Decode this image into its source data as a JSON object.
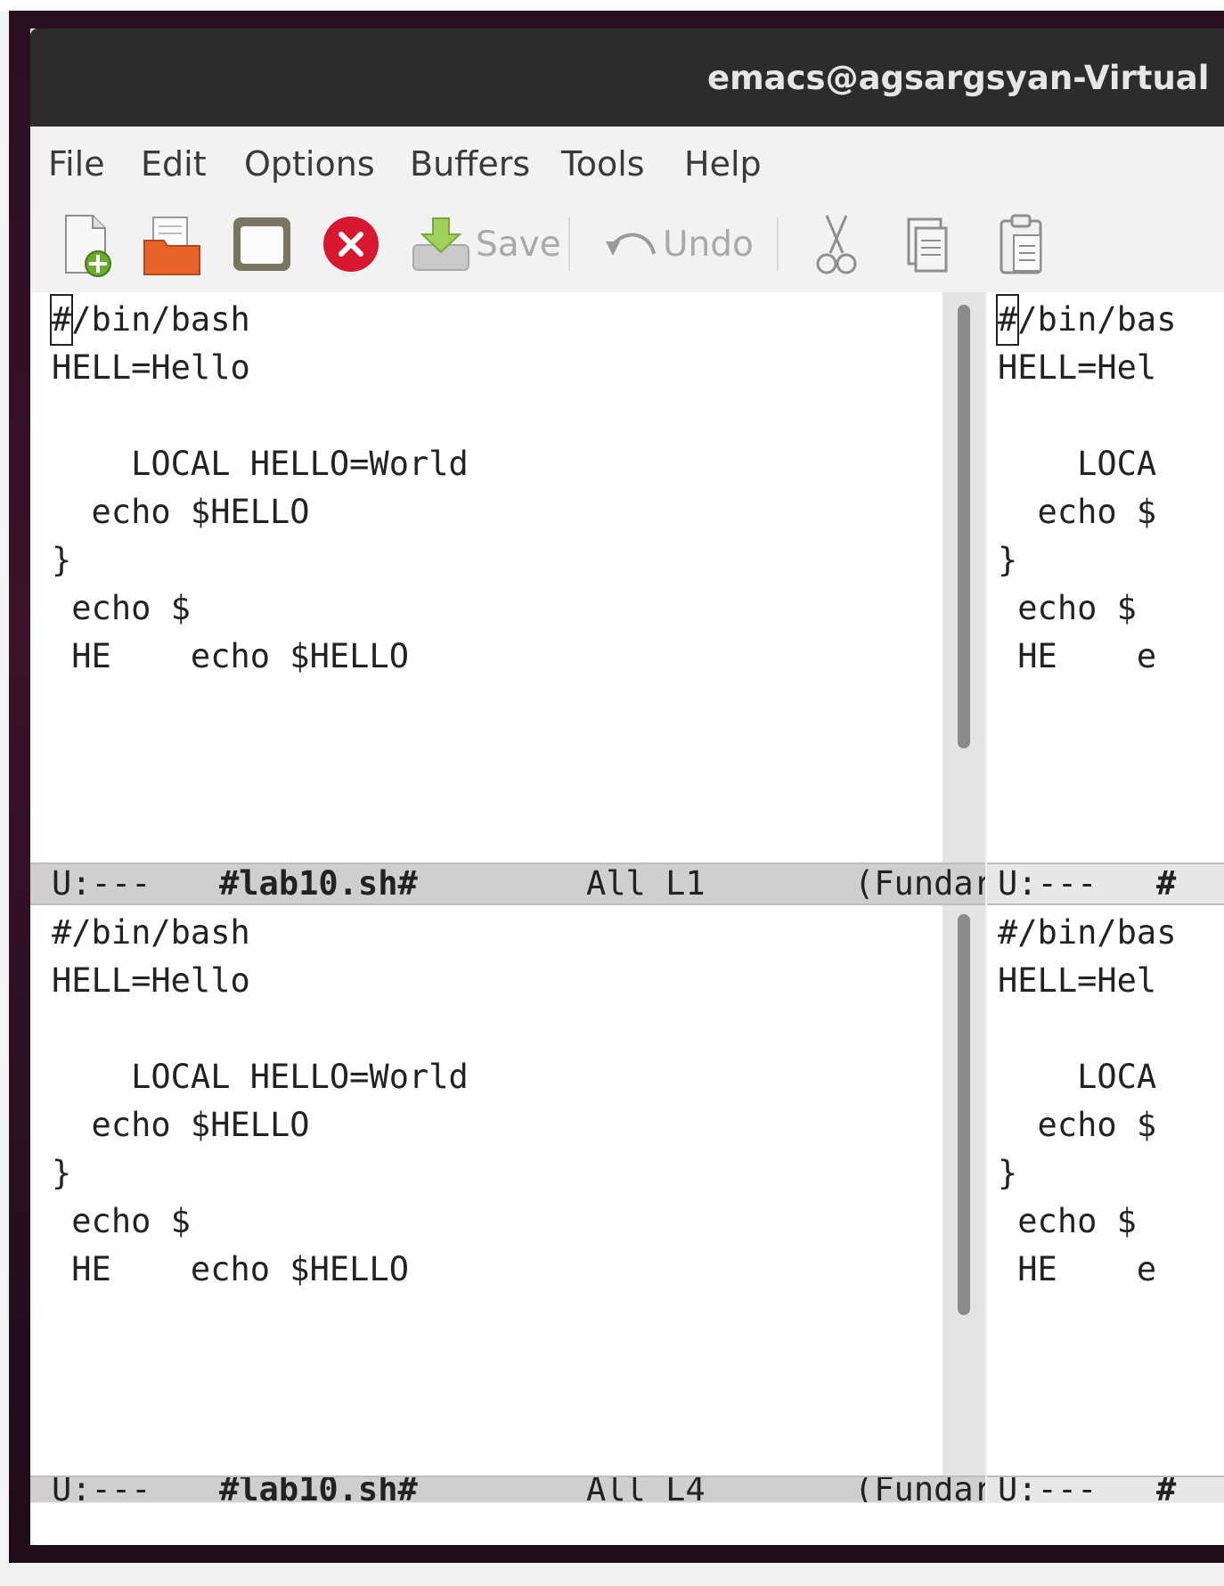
{
  "window": {
    "title": "emacs@agsargsyan-Virtual"
  },
  "menu": [
    "File",
    "Edit",
    "Options",
    "Buffers",
    "Tools",
    "Help"
  ],
  "toolbar": {
    "save_label": "Save",
    "undo_label": "Undo"
  },
  "icons": {
    "new_file": "new-file-icon",
    "open_folder": "folder-icon",
    "window": "window-icon",
    "close": "close-icon",
    "save": "save-icon",
    "undo": "undo-icon",
    "cut": "scissors-icon",
    "copy": "copy-icon",
    "paste": "paste-icon"
  },
  "buffer_lines": [
    "#/bin/bash",
    "HELL=Hello",
    "",
    "    LOCAL HELLO=World",
    "  echo $HELLO",
    "}",
    " echo $",
    " HE    echo $HELLO"
  ],
  "right_buffer_lines": [
    "#/bin/bas",
    "HELL=Hel",
    "",
    "    LOCA",
    "  echo $",
    "}",
    " echo $",
    " HE    e"
  ],
  "modeline_top_left": {
    "status": "U:---",
    "buffer": "#lab10.sh#",
    "position": "All L1",
    "mode": "(Fundar"
  },
  "modeline_bottom_left": {
    "status": "U:---",
    "buffer": "#lab10.sh#",
    "position": "All L4",
    "mode": "(Fundar"
  },
  "modeline_top_right": {
    "status": "U:---",
    "buffer": "#"
  },
  "modeline_bottom_right": {
    "status": "U:---",
    "buffer": "#"
  },
  "colors": {
    "titlebar": "#2c2c2c",
    "close_red": "#d7172f",
    "folder_orange": "#e8622a"
  }
}
